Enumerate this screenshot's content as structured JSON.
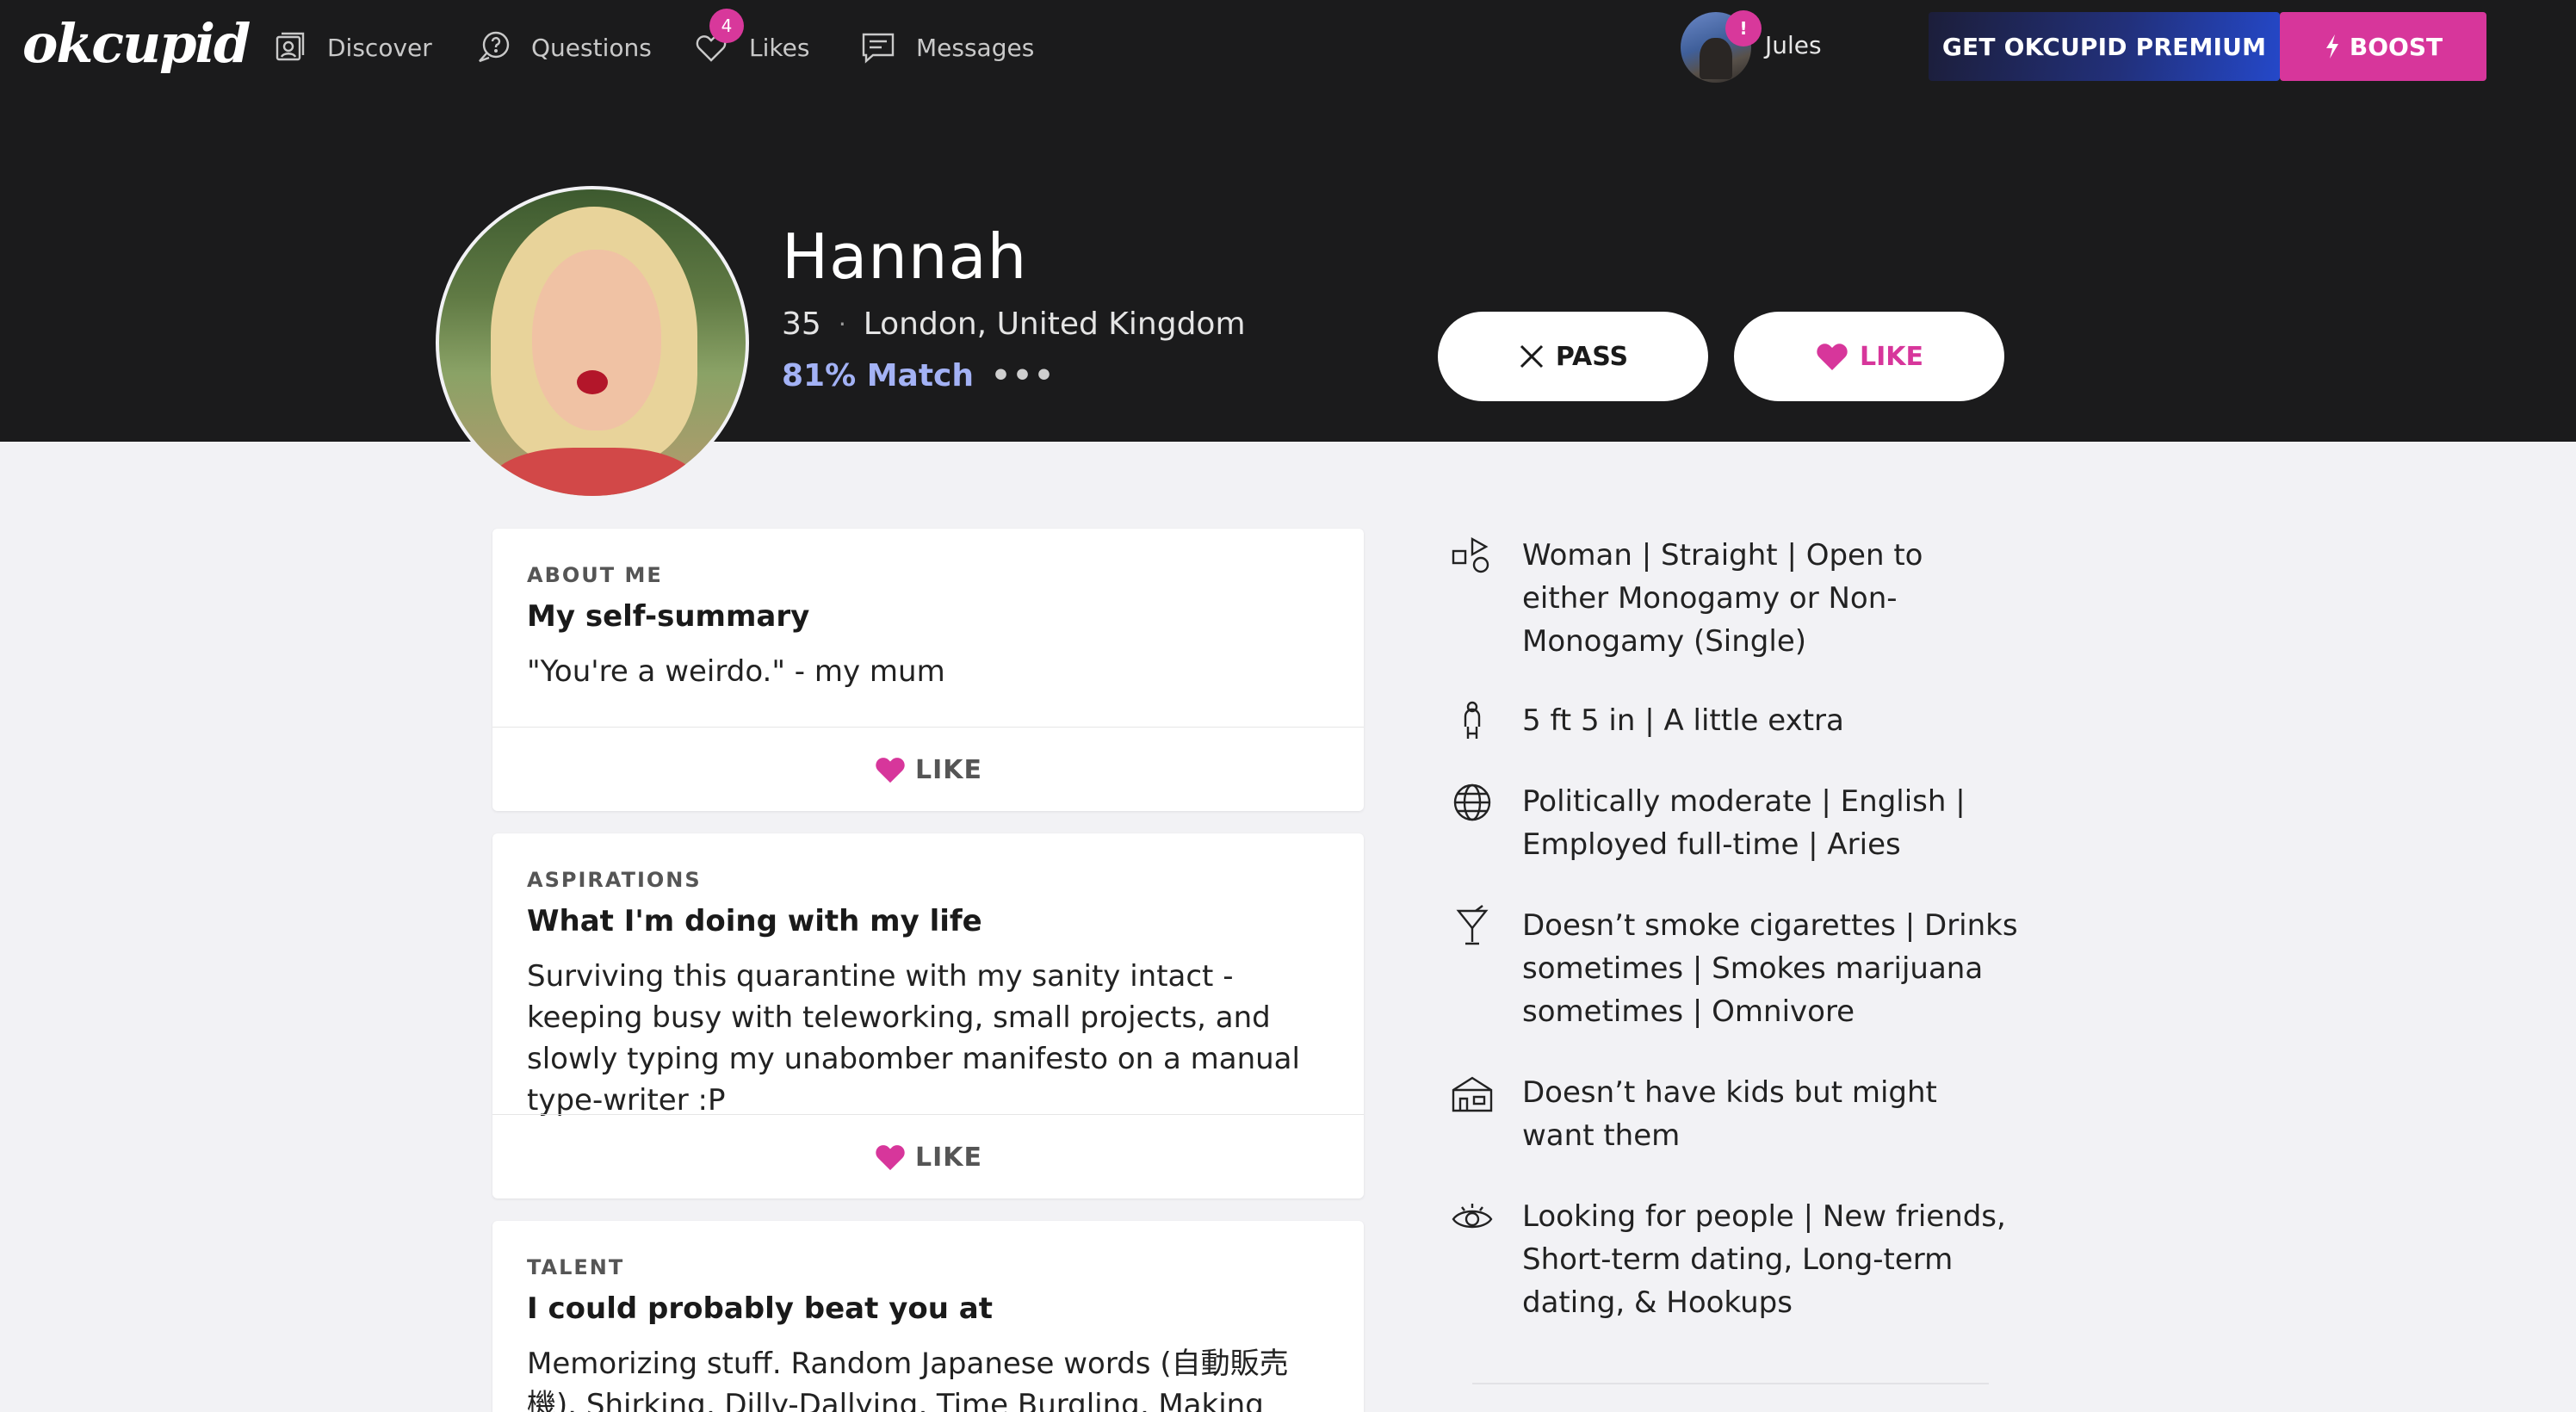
{
  "brand": {
    "logo": "okcupid",
    "accent": "#d7369b",
    "match_color": "#a3b2f5"
  },
  "nav": {
    "items": [
      {
        "label": "Discover",
        "icon": "discover-icon"
      },
      {
        "label": "Questions",
        "icon": "question-icon"
      },
      {
        "label": "Likes",
        "icon": "heart-outline-icon"
      },
      {
        "label": "Messages",
        "icon": "messages-icon"
      }
    ],
    "likes_badge": "4",
    "user": {
      "name": "Jules",
      "badge": "!"
    },
    "premium_label": "GET OKCUPID PREMIUM",
    "boost_label": "BOOST"
  },
  "profile": {
    "name": "Hannah",
    "age": "35",
    "location": "London, United Kingdom",
    "match": "81% Match",
    "pass_label": "PASS",
    "like_label": "LIKE"
  },
  "essays": [
    {
      "label": "ABOUT ME",
      "title": "My self-summary",
      "body": "\"You're a weirdo.\" - my mum",
      "like_label": "LIKE"
    },
    {
      "label": "ASPIRATIONS",
      "title": "What I'm doing with my life",
      "body": "Surviving this quarantine with my sanity intact - keeping busy with teleworking, small projects, and slowly typing my unabomber manifesto on a manual type-writer :P",
      "like_label": "LIKE"
    },
    {
      "label": "TALENT",
      "title": "I could probably beat you at",
      "body": "Memorizing stuff. Random Japanese words (自動販売機). Shirking, Dilly-Dallying, Time Burgling, Making music"
    }
  ],
  "details": [
    {
      "icon": "gender-shapes-icon",
      "text": "Woman | Straight | Open to either Monogamy or Non-Monogamy (Single)"
    },
    {
      "icon": "person-icon",
      "text": "5 ft 5 in | A little extra"
    },
    {
      "icon": "globe-icon",
      "text": "Politically moderate | English | Employed full-time | Aries"
    },
    {
      "icon": "martini-icon",
      "text": "Doesn’t smoke cigarettes | Drinks sometimes | Smokes marijuana sometimes | Omnivore"
    },
    {
      "icon": "house-icon",
      "text": "Doesn’t have kids but might want them"
    },
    {
      "icon": "eye-icon",
      "text": "Looking for people | New friends, Short-term dating, Long-term dating, & Hookups"
    }
  ]
}
